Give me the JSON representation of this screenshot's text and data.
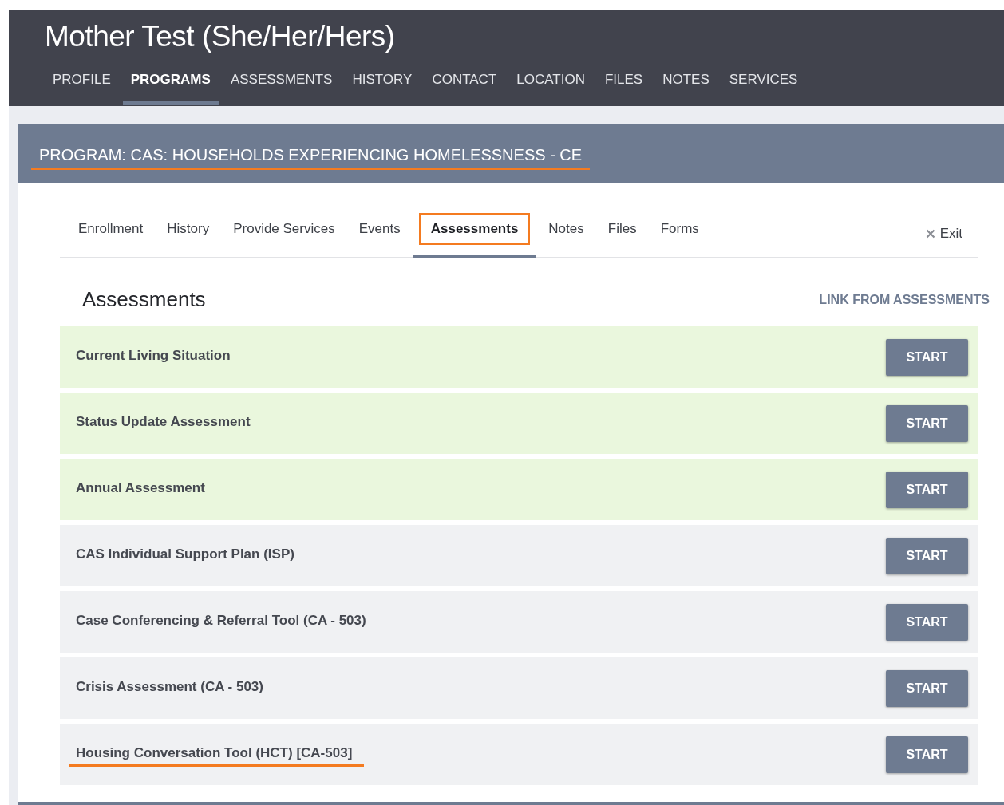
{
  "client": {
    "name": "Mother Test (She/Her/Hers)"
  },
  "main_tabs": [
    {
      "label": "PROFILE",
      "selected": false
    },
    {
      "label": "PROGRAMS",
      "selected": true
    },
    {
      "label": "ASSESSMENTS",
      "selected": false
    },
    {
      "label": "HISTORY",
      "selected": false
    },
    {
      "label": "CONTACT",
      "selected": false
    },
    {
      "label": "LOCATION",
      "selected": false
    },
    {
      "label": "FILES",
      "selected": false
    },
    {
      "label": "NOTES",
      "selected": false
    },
    {
      "label": "SERVICES",
      "selected": false
    }
  ],
  "program": {
    "title": "PROGRAM: CAS: HOUSEHOLDS EXPERIENCING HOMELESSNESS - CE",
    "annotated": true
  },
  "program_tabs": [
    {
      "label": "Enrollment",
      "selected": false,
      "annotated": false
    },
    {
      "label": "History",
      "selected": false,
      "annotated": false
    },
    {
      "label": "Provide Services",
      "selected": false,
      "annotated": false
    },
    {
      "label": "Events",
      "selected": false,
      "annotated": false
    },
    {
      "label": "Assessments",
      "selected": true,
      "annotated": true
    },
    {
      "label": "Notes",
      "selected": false,
      "annotated": false
    },
    {
      "label": "Files",
      "selected": false,
      "annotated": false
    },
    {
      "label": "Forms",
      "selected": false,
      "annotated": false
    }
  ],
  "exit": {
    "label": "Exit"
  },
  "section": {
    "title": "Assessments",
    "link": "LINK FROM ASSESSMENTS"
  },
  "assessments": [
    {
      "name": "Current Living Situation",
      "highlighted": true,
      "annotated": false,
      "action": "START"
    },
    {
      "name": "Status Update Assessment",
      "highlighted": true,
      "annotated": false,
      "action": "START"
    },
    {
      "name": "Annual Assessment",
      "highlighted": true,
      "annotated": false,
      "action": "START"
    },
    {
      "name": "CAS Individual Support Plan (ISP)",
      "highlighted": false,
      "annotated": false,
      "action": "START"
    },
    {
      "name": "Case Conferencing & Referral Tool (CA - 503)",
      "highlighted": false,
      "annotated": false,
      "action": "START"
    },
    {
      "name": "Crisis Assessment (CA - 503)",
      "highlighted": false,
      "annotated": false,
      "action": "START"
    },
    {
      "name": "Housing Conversation Tool (HCT) [CA-503]",
      "highlighted": false,
      "annotated": true,
      "action": "START"
    }
  ]
}
